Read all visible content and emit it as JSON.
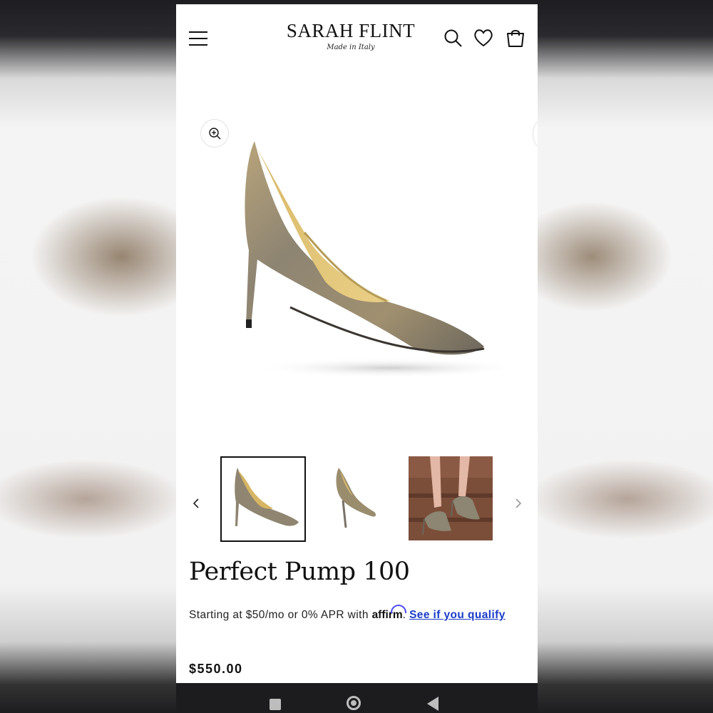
{
  "header": {
    "brand_name": "SARAH FLINT",
    "brand_tagline": "Made in Italy",
    "icons": [
      "menu-icon",
      "search-icon",
      "heart-icon",
      "cart-icon"
    ]
  },
  "gallery": {
    "icons": [
      "zoom-in-icon",
      "chevron-left-icon",
      "chevron-right-icon"
    ],
    "thumbnails": [
      {
        "name": "thumbnail-side-view",
        "active": true
      },
      {
        "name": "thumbnail-back-view",
        "active": false
      },
      {
        "name": "thumbnail-worn-on-steps",
        "active": false
      }
    ]
  },
  "product": {
    "title": "Perfect Pump 100",
    "financing_prefix": "Starting at $50/mo or 0% APR with ",
    "affirm_logo_text": "affirm",
    "financing_suffix": ". ",
    "financing_link": "See if you qualify",
    "price": "$550.00"
  },
  "system_nav": {
    "icons": [
      "recents-icon",
      "home-icon",
      "back-icon"
    ]
  },
  "colors": {
    "link": "#1a3bc8",
    "affirm_arc": "#4a4af4",
    "text": "#111111",
    "navbar": "#1c1c1f"
  }
}
